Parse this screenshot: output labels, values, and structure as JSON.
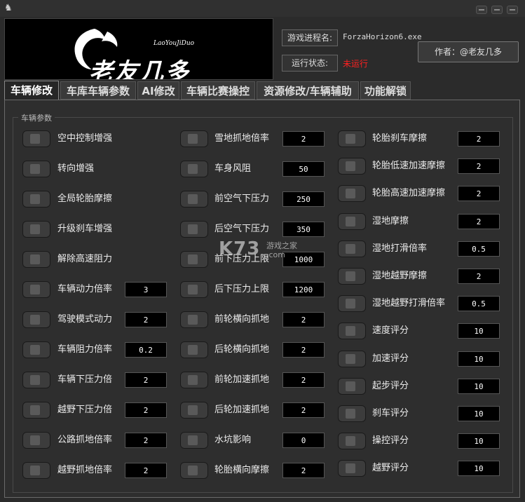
{
  "header": {
    "logo_text": "老友几多",
    "logo_subtext": "LaoYouJiDuo",
    "process_label": "游戏进程名:",
    "process_value": "ForzaHorizon6.exe",
    "status_label": "运行状态:",
    "status_value": "未运行",
    "status_color": "#ff2020",
    "author_button": "作者：@老友几多"
  },
  "tabs": [
    "车辆修改",
    "车库车辆参数",
    "AI修改",
    "车辆比赛操控",
    "资源修改/车辆辅助",
    "功能解锁"
  ],
  "active_tab": "车辆修改",
  "group_title": "车辆参数",
  "columns": [
    [
      {
        "label": "空中控制增强",
        "value": null
      },
      {
        "label": "转向增强",
        "value": null
      },
      {
        "label": "全局轮胎摩擦",
        "value": null
      },
      {
        "label": "升级刹车增强",
        "value": null
      },
      {
        "label": "解除高速阻力",
        "value": null
      },
      {
        "label": "车辆动力倍率",
        "value": "3"
      },
      {
        "label": "驾驶模式动力",
        "value": "2"
      },
      {
        "label": "车辆阻力倍率",
        "value": "0.2"
      },
      {
        "label": "车辆下压力倍",
        "value": "2"
      },
      {
        "label": "越野下压力倍",
        "value": "2"
      },
      {
        "label": "公路抓地倍率",
        "value": "2"
      },
      {
        "label": "越野抓地倍率",
        "value": "2"
      }
    ],
    [
      {
        "label": "雪地抓地倍率",
        "value": "2"
      },
      {
        "label": "车身风阻",
        "value": "50"
      },
      {
        "label": "前空气下压力",
        "value": "250"
      },
      {
        "label": "后空气下压力",
        "value": "350"
      },
      {
        "label": "前下压力上限",
        "value": "1000"
      },
      {
        "label": "后下压力上限",
        "value": "1200"
      },
      {
        "label": "前轮横向抓地",
        "value": "2"
      },
      {
        "label": "后轮横向抓地",
        "value": "2"
      },
      {
        "label": "前轮加速抓地",
        "value": "2"
      },
      {
        "label": "后轮加速抓地",
        "value": "2"
      },
      {
        "label": "水坑影响",
        "value": "0"
      },
      {
        "label": "轮胎横向摩擦",
        "value": "2"
      }
    ],
    [
      {
        "label": "轮胎刹车摩擦",
        "value": "2"
      },
      {
        "label": "轮胎低速加速摩擦",
        "value": "2"
      },
      {
        "label": "轮胎高速加速摩擦",
        "value": "2"
      },
      {
        "label": "湿地摩擦",
        "value": "2"
      },
      {
        "label": "湿地打滑倍率",
        "value": "0.5"
      },
      {
        "label": "湿地越野摩擦",
        "value": "2"
      },
      {
        "label": "湿地越野打滑倍率",
        "value": "0.5"
      },
      {
        "label": "速度评分",
        "value": "10"
      },
      {
        "label": "加速评分",
        "value": "10"
      },
      {
        "label": "起步评分",
        "value": "10"
      },
      {
        "label": "刹车评分",
        "value": "10"
      },
      {
        "label": "操控评分",
        "value": "10"
      },
      {
        "label": "越野评分",
        "value": "10"
      }
    ]
  ],
  "watermark": {
    "brand": "K73",
    "name": "游戏之家",
    "domain": ".com"
  }
}
